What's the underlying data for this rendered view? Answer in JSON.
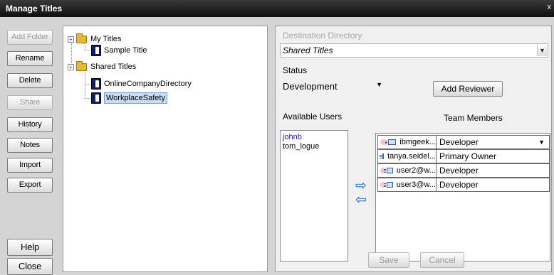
{
  "window": {
    "title": "Manage Titles",
    "close_glyph": "x"
  },
  "buttons": {
    "add_folder": "Add Folder",
    "rename": "Rename",
    "delete": "Delete",
    "share": "Share",
    "history": "History",
    "notes": "Notes",
    "import": "Import",
    "export": "Export",
    "help": "Help",
    "close": "Close"
  },
  "tree": {
    "my_titles": "My Titles",
    "sample_title": "Sample Title",
    "shared_titles": "Shared Titles",
    "online_company_directory": "OnlineCompanyDirectory",
    "workplace_safety": "WorkplaceSafety",
    "expander_glyph": "+",
    "selected": "WorkplaceSafety"
  },
  "destination": {
    "label": "Destination Directory",
    "value": "Shared Titles"
  },
  "status": {
    "label": "Status",
    "value": "Development"
  },
  "add_reviewer": "Add Reviewer",
  "available_users": {
    "label": "Available Users",
    "items": [
      "johnb",
      "tom_logue"
    ]
  },
  "team_members": {
    "label": "Team Members",
    "rows": [
      {
        "name": "ibmgeek...",
        "role": "Developer",
        "has_bubble": true
      },
      {
        "name": "tanya.seidel...",
        "role": "Primary Owner",
        "has_bubble": false
      },
      {
        "name": "user2@w...",
        "role": "Developer",
        "has_bubble": true
      },
      {
        "name": "user3@w...",
        "role": "Developer",
        "has_bubble": true
      }
    ]
  },
  "transfer": {
    "add_glyph": "⇨",
    "remove_glyph": "⇦"
  },
  "footer": {
    "save": "Save",
    "cancel": "Cancel"
  },
  "icons": {
    "expander": "plus-expander-icon",
    "folder": "folder-icon",
    "title_doc": "title-document-icon",
    "chat": "chat-bubble-icon",
    "contact": "contact-card-icon"
  }
}
